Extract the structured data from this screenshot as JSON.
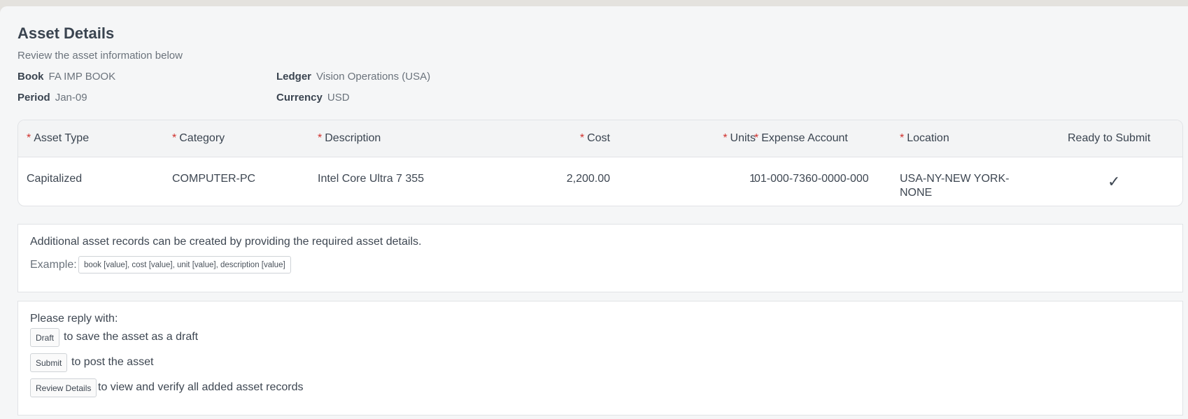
{
  "header": {
    "title": "Asset Details",
    "subtitle": "Review the asset information below"
  },
  "meta": {
    "book_label": "Book",
    "book_value": "FA IMP BOOK",
    "ledger_label": "Ledger",
    "ledger_value": "Vision Operations (USA)",
    "period_label": "Period",
    "period_value": "Jan-09",
    "currency_label": "Currency",
    "currency_value": "USD"
  },
  "table": {
    "required_marker": "*",
    "columns": [
      "Asset Type",
      "Category",
      "Description",
      "Cost",
      "Units",
      "Expense Account",
      "Location",
      "Ready to Submit"
    ],
    "rows": [
      {
        "asset_type": "Capitalized",
        "category": "COMPUTER-PC",
        "description": "Intel Core Ultra 7 355",
        "cost": "2,200.00",
        "units": "1",
        "expense_account": "01-000-7360-0000-000",
        "location_line1": "USA-NY-NEW YORK-",
        "location_line2": "NONE",
        "ready": "✓"
      }
    ]
  },
  "info": {
    "text": "Additional asset records can be created by providing the required asset details.",
    "example_label": "Example:",
    "example_value": "book [value], cost [value], unit [value], description [value]"
  },
  "reply": {
    "intro": "Please reply with:",
    "options": [
      {
        "command": "Draft",
        "text": "to save the asset as a draft"
      },
      {
        "command": "Submit",
        "text": "to post the asset"
      },
      {
        "command": "Review Details",
        "text": "to view and verify all added asset records"
      }
    ]
  }
}
